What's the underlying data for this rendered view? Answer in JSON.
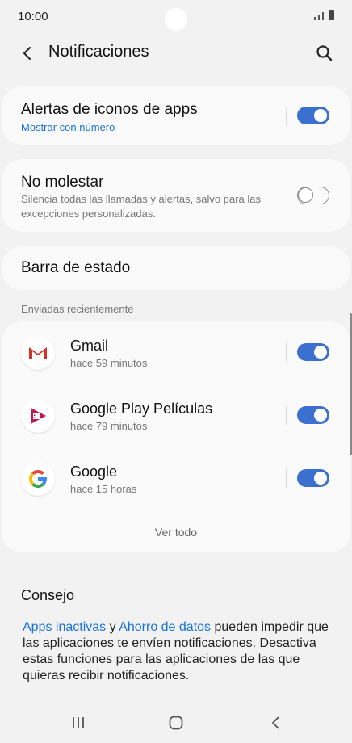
{
  "status_bar": {
    "time": "10:00"
  },
  "header": {
    "title": "Notificaciones"
  },
  "app_badges": {
    "title": "Alertas de iconos de apps",
    "subtitle": "Mostrar con número",
    "enabled": true
  },
  "dnd": {
    "title": "No molestar",
    "description": "Silencia todas las llamadas y alertas, salvo para las excepciones personalizadas.",
    "enabled": false
  },
  "status_bar_row": {
    "title": "Barra de estado"
  },
  "recent": {
    "section_label": "Enviadas recientemente",
    "apps": [
      {
        "name": "Gmail",
        "time": "hace 59 minutos",
        "icon": "gmail-icon",
        "enabled": true
      },
      {
        "name": "Google Play Películas",
        "time": "hace 79 minutos",
        "icon": "play-movies-icon",
        "enabled": true
      },
      {
        "name": "Google",
        "time": "hace 15 horas",
        "icon": "google-icon",
        "enabled": true
      }
    ],
    "view_all": "Ver todo"
  },
  "tip": {
    "title": "Consejo",
    "link_1": "Apps inactivas",
    "connector": "y",
    "link_2": "Ahorro de datos",
    "text": "pueden impedir que las aplicaciones te envíen notificaciones. Desactiva estas funciones para las aplicaciones de las que quieras recibir notificaciones."
  },
  "colors": {
    "accent": "#3b6fd0",
    "link": "#1a73d9",
    "background": "#f2f2f2",
    "card": "#fafafa"
  }
}
